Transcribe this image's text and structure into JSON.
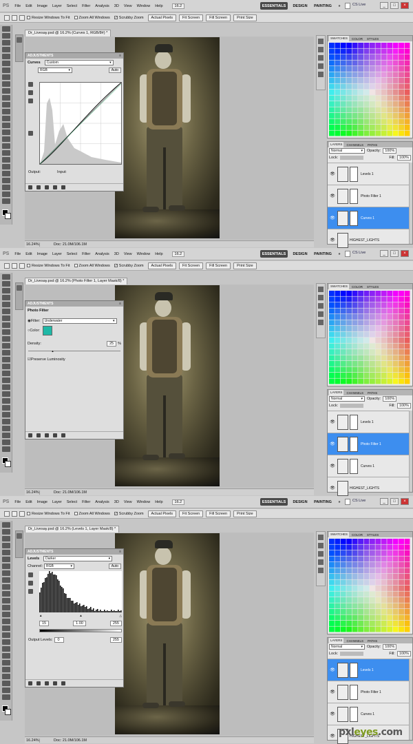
{
  "menu": [
    "File",
    "Edit",
    "Image",
    "Layer",
    "Select",
    "Filter",
    "Analysis",
    "3D",
    "View",
    "Window",
    "Help"
  ],
  "ps_label": "PS",
  "zoom_box": "16.2",
  "workspaces": {
    "essentials": "ESSENTIALS",
    "design": "DESIGN",
    "painting": "PAINTING",
    "more": "»"
  },
  "cs_live": "CS Live",
  "win_ctrls": [
    "_",
    "□",
    "×"
  ],
  "options": {
    "resize": "Resize Windows To Fit",
    "zoom_all": "Zoom All Windows",
    "scrubby": "Scrubby Zoom",
    "actual": "Actual Pixels",
    "fit": "Fit Screen",
    "fill": "Fill Screen",
    "print": "Print Size"
  },
  "panels": [
    {
      "doc_tab": "Dr_Livesay.psd @ 16.2% (Curves 1, RGB/8#) *",
      "adj_title": "ADJUSTMENTS",
      "adj_name": "Curves",
      "preset": "Custom",
      "channel": "RGB",
      "auto": "Auto",
      "output_label": "Output:",
      "input_label": "Input:",
      "status_zoom": "16.24%",
      "status_doc": "Doc: 21.0M/106.1M"
    },
    {
      "doc_tab": "Dr_Livesay.psd @ 16.2% (Photo Filter 1, Layer Mask/8) *",
      "adj_title": "ADJUSTMENTS",
      "adj_name": "Photo Filter",
      "filter_label": "Filter:",
      "filter_value": "Underwater",
      "color_label": "Color:",
      "swatch_color": "#1fb8a6",
      "density_label": "Density:",
      "density_value": "25",
      "density_unit": "%",
      "preserve": "Preserve Luminosity",
      "status_zoom": "16.24%",
      "status_doc": "Doc: 21.0M/106.1M"
    },
    {
      "doc_tab": "Dr_Livesay.psd @ 16.2% (Levels 1, Layer Mask/8) *",
      "adj_title": "ADJUSTMENTS",
      "adj_name": "Levels",
      "preset": "Darker",
      "channel_label": "Channel:",
      "channel": "RGB",
      "auto": "Auto",
      "input_black": "15",
      "input_mid": "1.00",
      "input_white": "255",
      "output_label": "Output Levels:",
      "output_black": "0",
      "output_white": "255",
      "status_zoom": "16.24%",
      "status_doc": "Doc: 21.0M/106.1M"
    }
  ],
  "swatch_tabs": [
    "SWATCHES",
    "COLOR",
    "STYLES"
  ],
  "layer_tabs": [
    "LAYERS",
    "CHANNELS",
    "PATHS"
  ],
  "blend": "Normal",
  "opacity_label": "Opacity:",
  "opacity_value": "100%",
  "lock_label": "Lock:",
  "fill_label": "Fill:",
  "fill_value": "100%",
  "layer_names": [
    "Levels 1",
    "Photo Filter 1",
    "Curves 1",
    "HIGHEST_LIGHTS"
  ],
  "selected_layers": [
    2,
    1,
    0
  ],
  "eye_glyph": "👁",
  "watermark": {
    "a": "pxl",
    "b": "eyes",
    ".c": ".com",
    "c": ".com"
  }
}
